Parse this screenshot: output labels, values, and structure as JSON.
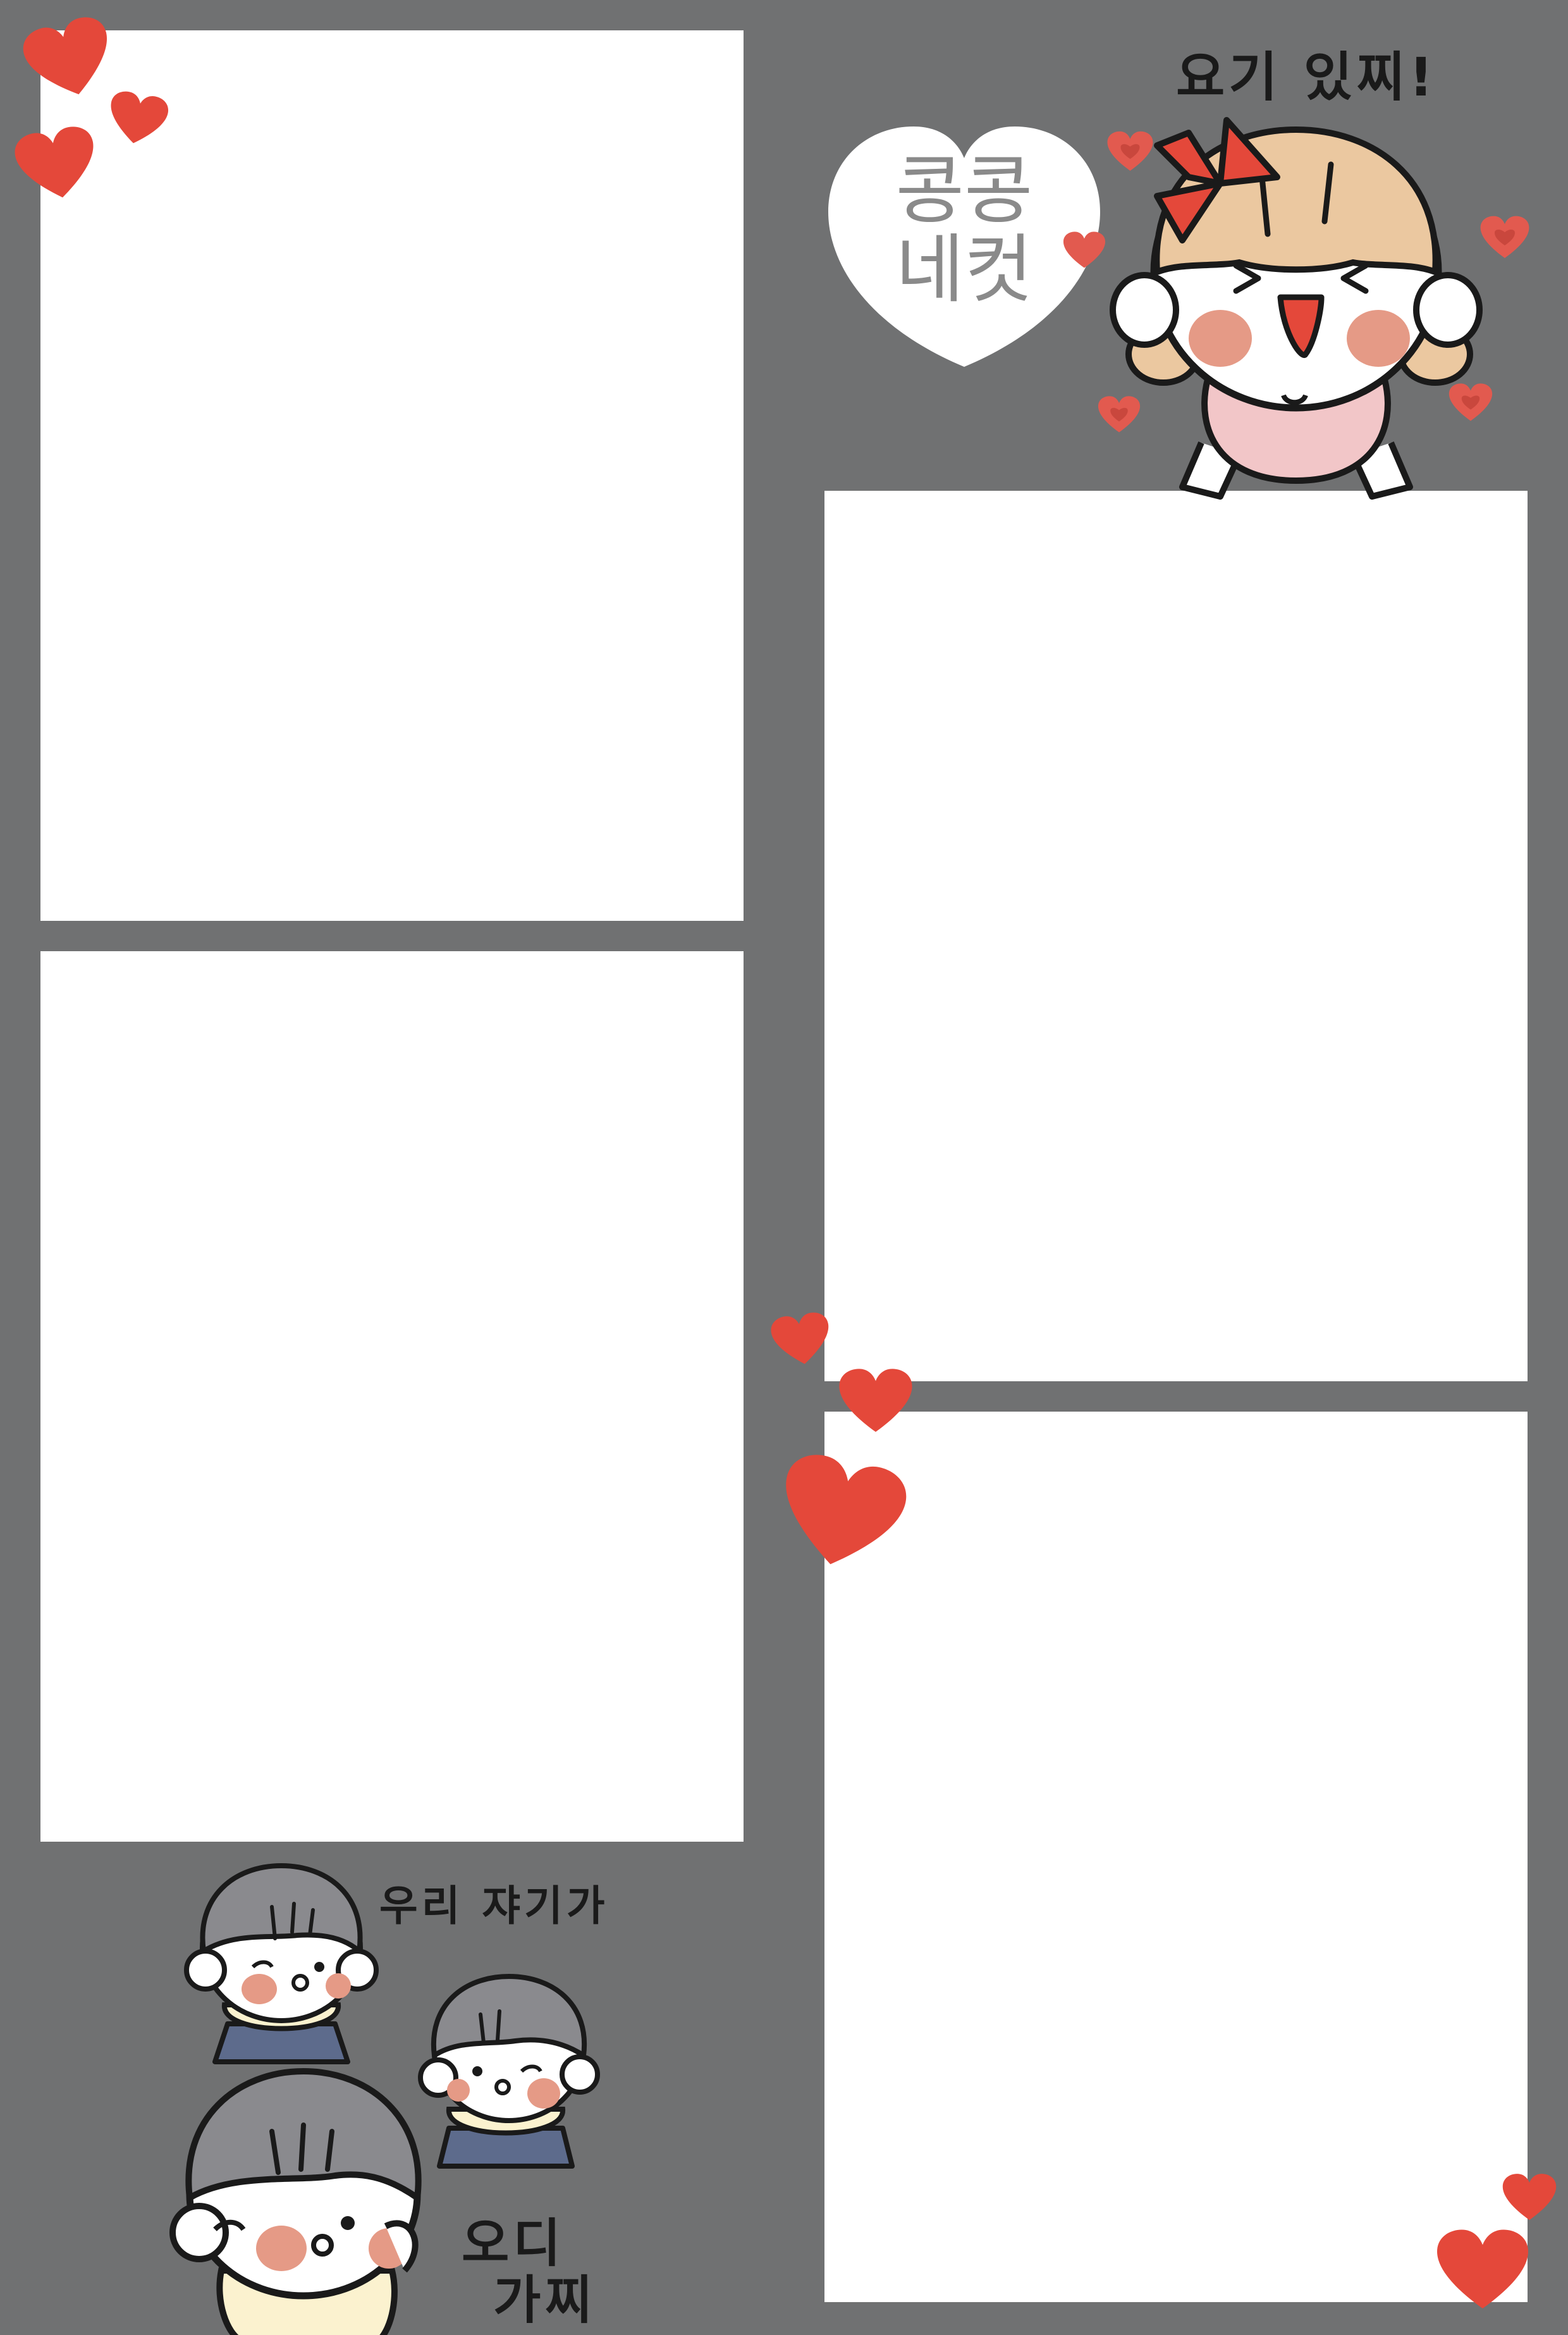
{
  "logo": {
    "line1": "콩콩",
    "line2": "네컷"
  },
  "speech": {
    "girl": "요기 있찌!",
    "boys_line1": "우리 쟈기가",
    "boys_line2a": "오디",
    "boys_line2b": "가찌"
  },
  "photo_slots": [
    {
      "label": "photo-slot-1"
    },
    {
      "label": "photo-slot-2"
    },
    {
      "label": "photo-slot-3"
    },
    {
      "label": "photo-slot-4"
    }
  ],
  "colors": {
    "background": "#707172",
    "frame": "#ffffff",
    "heart": "#e4483a",
    "heart_light": "#e25a4f",
    "hair_girl": "#ebc8a0",
    "hair_boy": "#8a8a8e",
    "blush": "#e59a86",
    "dress": "#f2c6c8",
    "bow": "#e4483a",
    "shirt": "#fbf2cf",
    "pants": "#5d6b8c"
  }
}
